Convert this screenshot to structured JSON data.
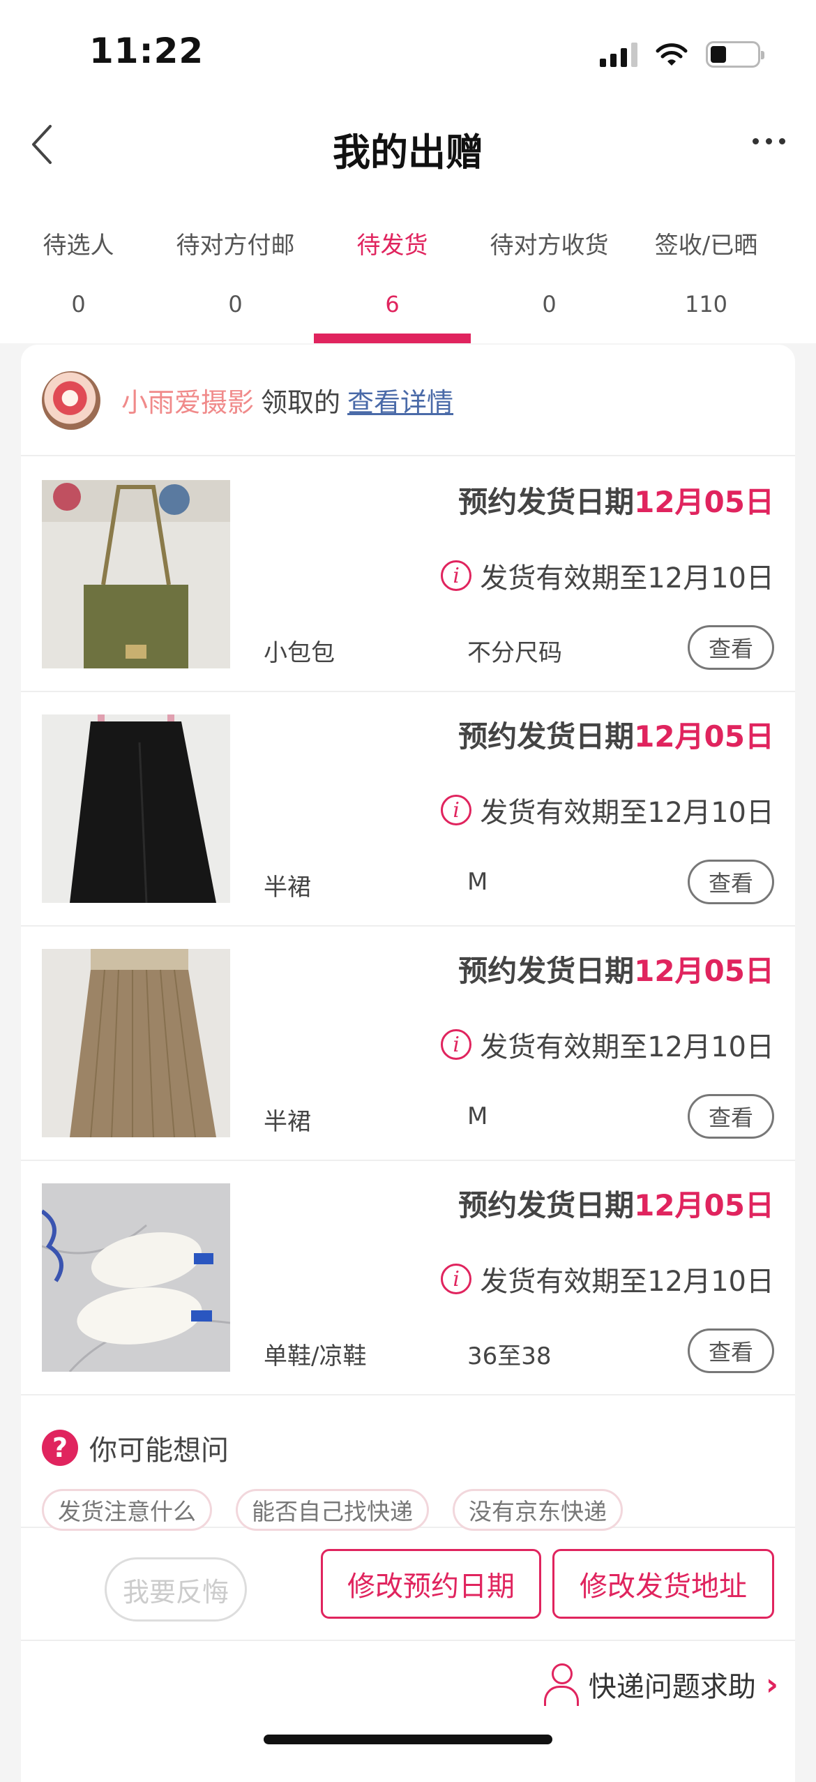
{
  "status_bar": {
    "time": "11:22"
  },
  "header": {
    "title": "我的出赠"
  },
  "tabs": [
    {
      "label": "待选人",
      "count": "0",
      "active": false
    },
    {
      "label": "待对方付邮",
      "count": "0",
      "active": false
    },
    {
      "label": "待发货",
      "count": "6",
      "active": true
    },
    {
      "label": "待对方收货",
      "count": "0",
      "active": false
    },
    {
      "label": "签收/已晒",
      "count": "110",
      "active": false
    }
  ],
  "giver": {
    "name": "小雨爱摄影",
    "suffix": "领取的",
    "link": "查看详情"
  },
  "schedule_label": "预约发货日期",
  "items": [
    {
      "name": "小包包",
      "size": "不分尺码",
      "date": "12月05日",
      "validity": "发货有效期至12月10日",
      "view_label": "查看",
      "thumb_icon": "bag-photo"
    },
    {
      "name": "半裙",
      "size": "M",
      "date": "12月05日",
      "validity": "发货有效期至12月10日",
      "view_label": "查看",
      "thumb_icon": "black-skirt-photo"
    },
    {
      "name": "半裙",
      "size": "M",
      "date": "12月05日",
      "validity": "发货有效期至12月10日",
      "view_label": "查看",
      "thumb_icon": "pleated-skirt-photo"
    },
    {
      "name": "单鞋/凉鞋",
      "size": "36至38",
      "date": "12月05日",
      "validity": "发货有效期至12月10日",
      "view_label": "查看",
      "thumb_icon": "sneakers-photo"
    }
  ],
  "faq": {
    "title": "你可能想问",
    "chips": [
      "发货注意什么",
      "能否自己找快递",
      "没有京东快递"
    ]
  },
  "actions": {
    "regret": "我要反悔",
    "change_date": "修改预约日期",
    "change_address": "修改发货地址"
  },
  "help": {
    "label": "快递问题求助"
  },
  "colors": {
    "accent": "#e0245e",
    "giver_name": "#f08a8a",
    "link": "#4a6aa8"
  }
}
